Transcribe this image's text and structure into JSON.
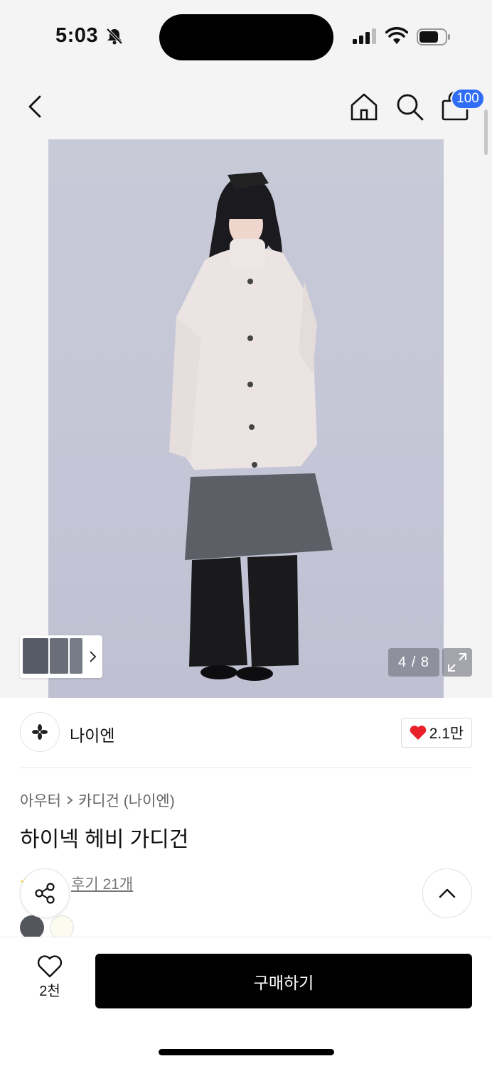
{
  "status_bar": {
    "time": "5:03"
  },
  "nav": {
    "cart_badge": "100"
  },
  "gallery": {
    "counter": "4 / 8"
  },
  "brand": {
    "name": "나이엔",
    "like_count": "2.1만"
  },
  "product": {
    "breadcrumb": [
      "아우터",
      "카디건 (나이엔)"
    ],
    "title": "하이넥 헤비 가디건",
    "reviews_label": "후기 21개",
    "swatches": [
      "#53565b",
      "#fbfbf0"
    ]
  },
  "bottom": {
    "wish_count": "2천",
    "buy_label": "구매하기"
  },
  "colors": {
    "badge": "#2f6df6",
    "heart": "#e8202a",
    "buy_button": "#000000"
  }
}
